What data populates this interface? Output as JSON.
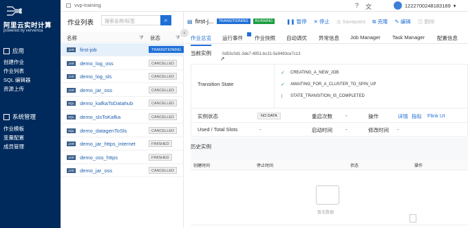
{
  "sidebar": {
    "brand_title": "阿里云实时计算",
    "brand_subtitle": "powered by ververica",
    "section1": "应用",
    "apps": [
      "创建作业",
      "作业列表",
      "SQL 编辑器",
      "资源上传"
    ],
    "section2": "系统管理",
    "system": [
      "作业模板",
      "变量配置",
      "成员管理"
    ]
  },
  "topbar": {
    "workspace": "vvp-training",
    "account": "1222700248183189"
  },
  "joblist": {
    "title": "作业列表",
    "search_placeholder": "搜索名称/标签",
    "col_name": "名称",
    "col_status": "状态",
    "rows": [
      {
        "type": "JAR",
        "name": "first-job",
        "status": "TRANSITIONING"
      },
      {
        "type": "JAR",
        "name": "demo_log_oss",
        "status": "CANCELLED"
      },
      {
        "type": "JAR",
        "name": "demo_log_sls",
        "status": "CANCELLED"
      },
      {
        "type": "JAR",
        "name": "demo_jar_oss",
        "status": "CANCELLED"
      },
      {
        "type": "SQL",
        "name": "demo_kafkaToDatahub",
        "status": "CANCELLED"
      },
      {
        "type": "SQL",
        "name": "demo_slsToKafka",
        "status": "CANCELLED"
      },
      {
        "type": "SQL",
        "name": "demo_datagenToSls",
        "status": "CANCELLED"
      },
      {
        "type": "JAR",
        "name": "demo_jar_https_internet",
        "status": "FINISHED"
      },
      {
        "type": "JAR",
        "name": "demo_oss_https",
        "status": "FINISHED"
      },
      {
        "type": "JAR",
        "name": "demo_jar_oss",
        "status": "CANCELLED"
      }
    ]
  },
  "job": {
    "name": "first-j...",
    "badge1": "TRANSITIONING",
    "badge2": "RUNNING",
    "actions": {
      "pause": "暂停",
      "stop": "停止",
      "savepoint": "Savepoint",
      "clone": "克隆",
      "edit": "编辑",
      "delete": "删除"
    }
  },
  "tabs": [
    "作业总览",
    "运行事件",
    "作业快照",
    "自动调优",
    "异常信息",
    "Job Manager",
    "Task Manager",
    "配置信息"
  ],
  "overview": {
    "current_label": "当前实例",
    "current_id": "0d53c0d1-3de7-4951-bc31-5e9493ce7c13",
    "transition_label": "Transition State",
    "steps": [
      "CREATING_A_NEW_JOB",
      "AWAITING_FOR_A_CLUSTER_TO_SPIN_UP",
      "STATE_TRANSITION_IS_COMPLETED"
    ],
    "inst_status_label": "实例状态",
    "inst_status": "NO DATA",
    "restart_label": "重启次数",
    "restart": "-",
    "ops_label": "操作",
    "ops": [
      "详情",
      "指标",
      "Flink UI"
    ],
    "slots_label": "Used / Total Slots",
    "slots": "-",
    "start_label": "启动时间",
    "start": "-",
    "modify_label": "修改时间",
    "modify": "-"
  },
  "history": {
    "title": "历史实例",
    "cols": [
      "创建时间",
      "停止时间",
      "状态",
      "操作"
    ],
    "empty": "暂无数据"
  }
}
